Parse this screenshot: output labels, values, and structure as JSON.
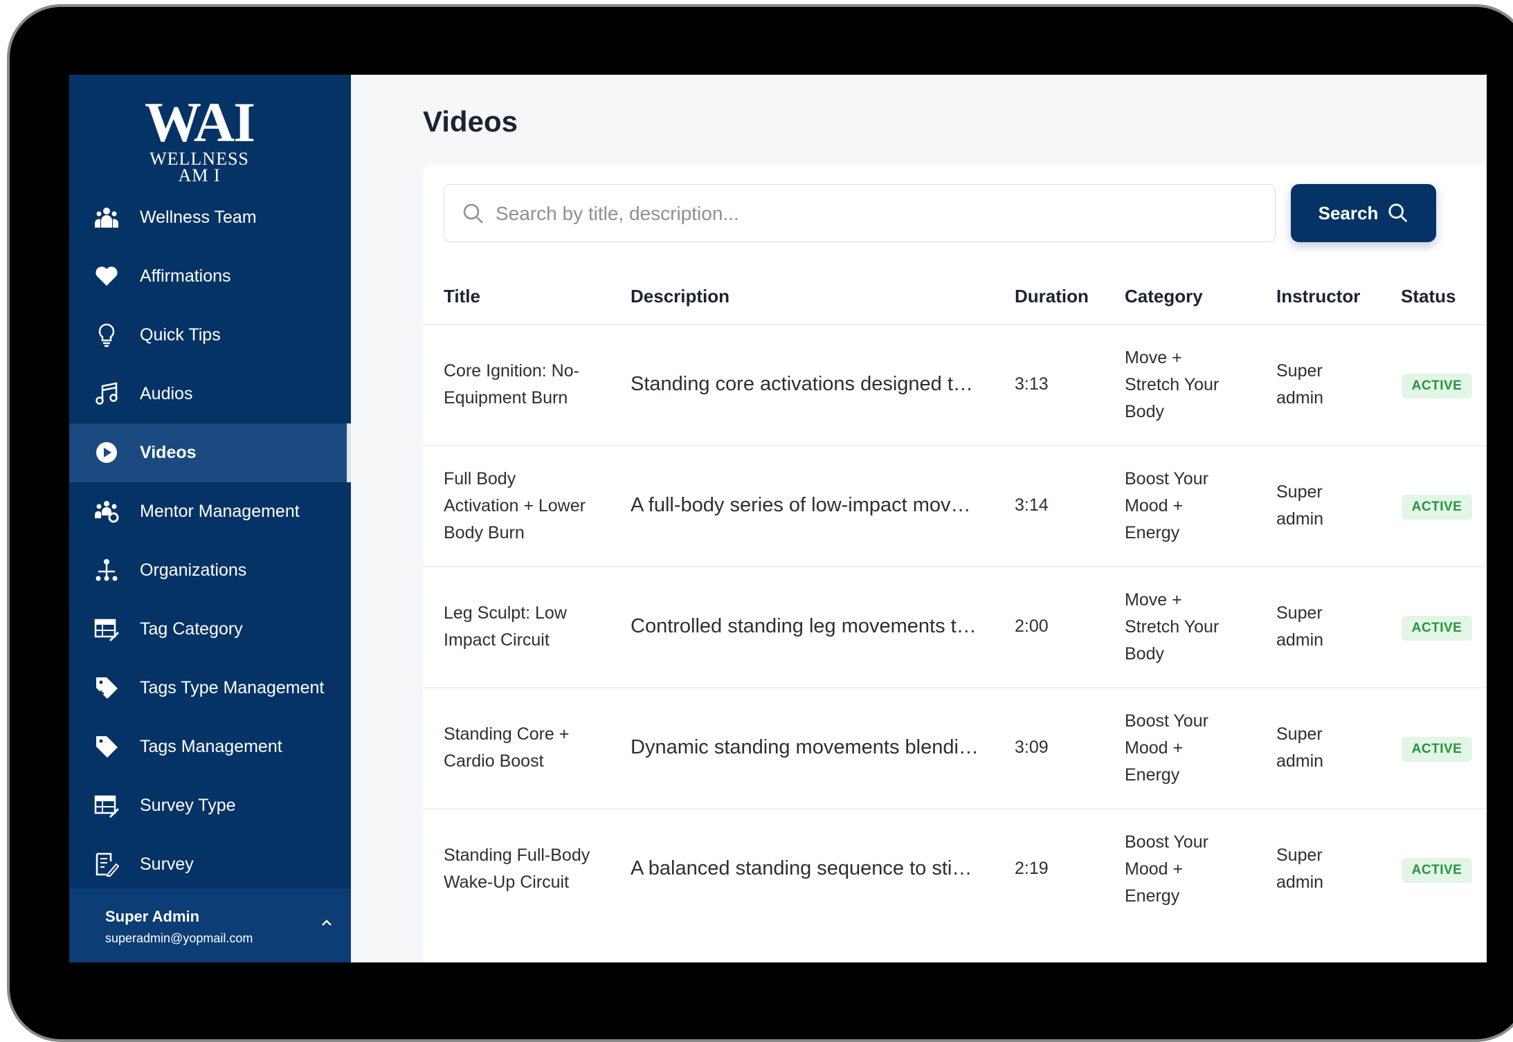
{
  "logo": {
    "big": "WAI",
    "line1": "WELLNESS",
    "line2": "AM I"
  },
  "sidebar": {
    "items": [
      {
        "label": "Wellness Team",
        "icon": "team-icon"
      },
      {
        "label": "Affirmations",
        "icon": "heart-icon"
      },
      {
        "label": "Quick Tips",
        "icon": "lightbulb-icon"
      },
      {
        "label": "Audios",
        "icon": "music-note-icon"
      },
      {
        "label": "Videos",
        "icon": "play-circle-icon",
        "active": true
      },
      {
        "label": "Mentor Management",
        "icon": "mentor-group-icon"
      },
      {
        "label": "Organizations",
        "icon": "hierarchy-icon"
      },
      {
        "label": "Tag Category",
        "icon": "table-edit-icon"
      },
      {
        "label": "Tags Type Management",
        "icon": "tag-add-icon"
      },
      {
        "label": "Tags Management",
        "icon": "tag-icon"
      },
      {
        "label": "Survey Type",
        "icon": "table-edit-icon"
      },
      {
        "label": "Survey",
        "icon": "survey-edit-icon"
      }
    ],
    "user": {
      "name": "Super Admin",
      "email": "superadmin@yopmail.com"
    }
  },
  "main": {
    "title": "Videos",
    "search": {
      "placeholder": "Search by title, description...",
      "value": "",
      "button_label": "Search"
    },
    "table": {
      "headers": [
        "Title",
        "Description",
        "Duration",
        "Category",
        "Instructor",
        "Status"
      ],
      "rows": [
        {
          "title": [
            "Core Ignition: No-",
            "Equipment Burn"
          ],
          "description": "Standing core activations designed t…",
          "duration": "3:13",
          "category": [
            "Move +",
            "Stretch Your",
            "Body"
          ],
          "instructor": [
            "Super",
            "admin"
          ],
          "status": "ACTIVE"
        },
        {
          "title": [
            "Full Body",
            "Activation + Lower",
            "Body Burn"
          ],
          "description": "A full-body series of low-impact mov…",
          "duration": "3:14",
          "category": [
            "Boost Your",
            "Mood +",
            "Energy"
          ],
          "instructor": [
            "Super",
            "admin"
          ],
          "status": "ACTIVE"
        },
        {
          "title": [
            "Leg Sculpt: Low",
            "Impact Circuit"
          ],
          "description": "Controlled standing leg movements t…",
          "duration": "2:00",
          "category": [
            "Move +",
            "Stretch Your",
            "Body"
          ],
          "instructor": [
            "Super",
            "admin"
          ],
          "status": "ACTIVE"
        },
        {
          "title": [
            "Standing Core +",
            "Cardio Boost"
          ],
          "description": "Dynamic standing movements blendi…",
          "duration": "3:09",
          "category": [
            "Boost Your",
            "Mood +",
            "Energy"
          ],
          "instructor": [
            "Super",
            "admin"
          ],
          "status": "ACTIVE"
        },
        {
          "title": [
            "Standing Full-Body",
            "Wake-Up Circuit"
          ],
          "description": "A balanced standing sequence to sti…",
          "duration": "2:19",
          "category": [
            "Boost Your",
            "Mood +",
            "Energy"
          ],
          "instructor": [
            "Super",
            "admin"
          ],
          "status": "ACTIVE"
        }
      ]
    }
  },
  "colors": {
    "sidebar": "#063366",
    "active_item": "#1a4a80",
    "button": "#063366",
    "status_bg": "#e3f5e6",
    "status_text": "#27933c"
  }
}
